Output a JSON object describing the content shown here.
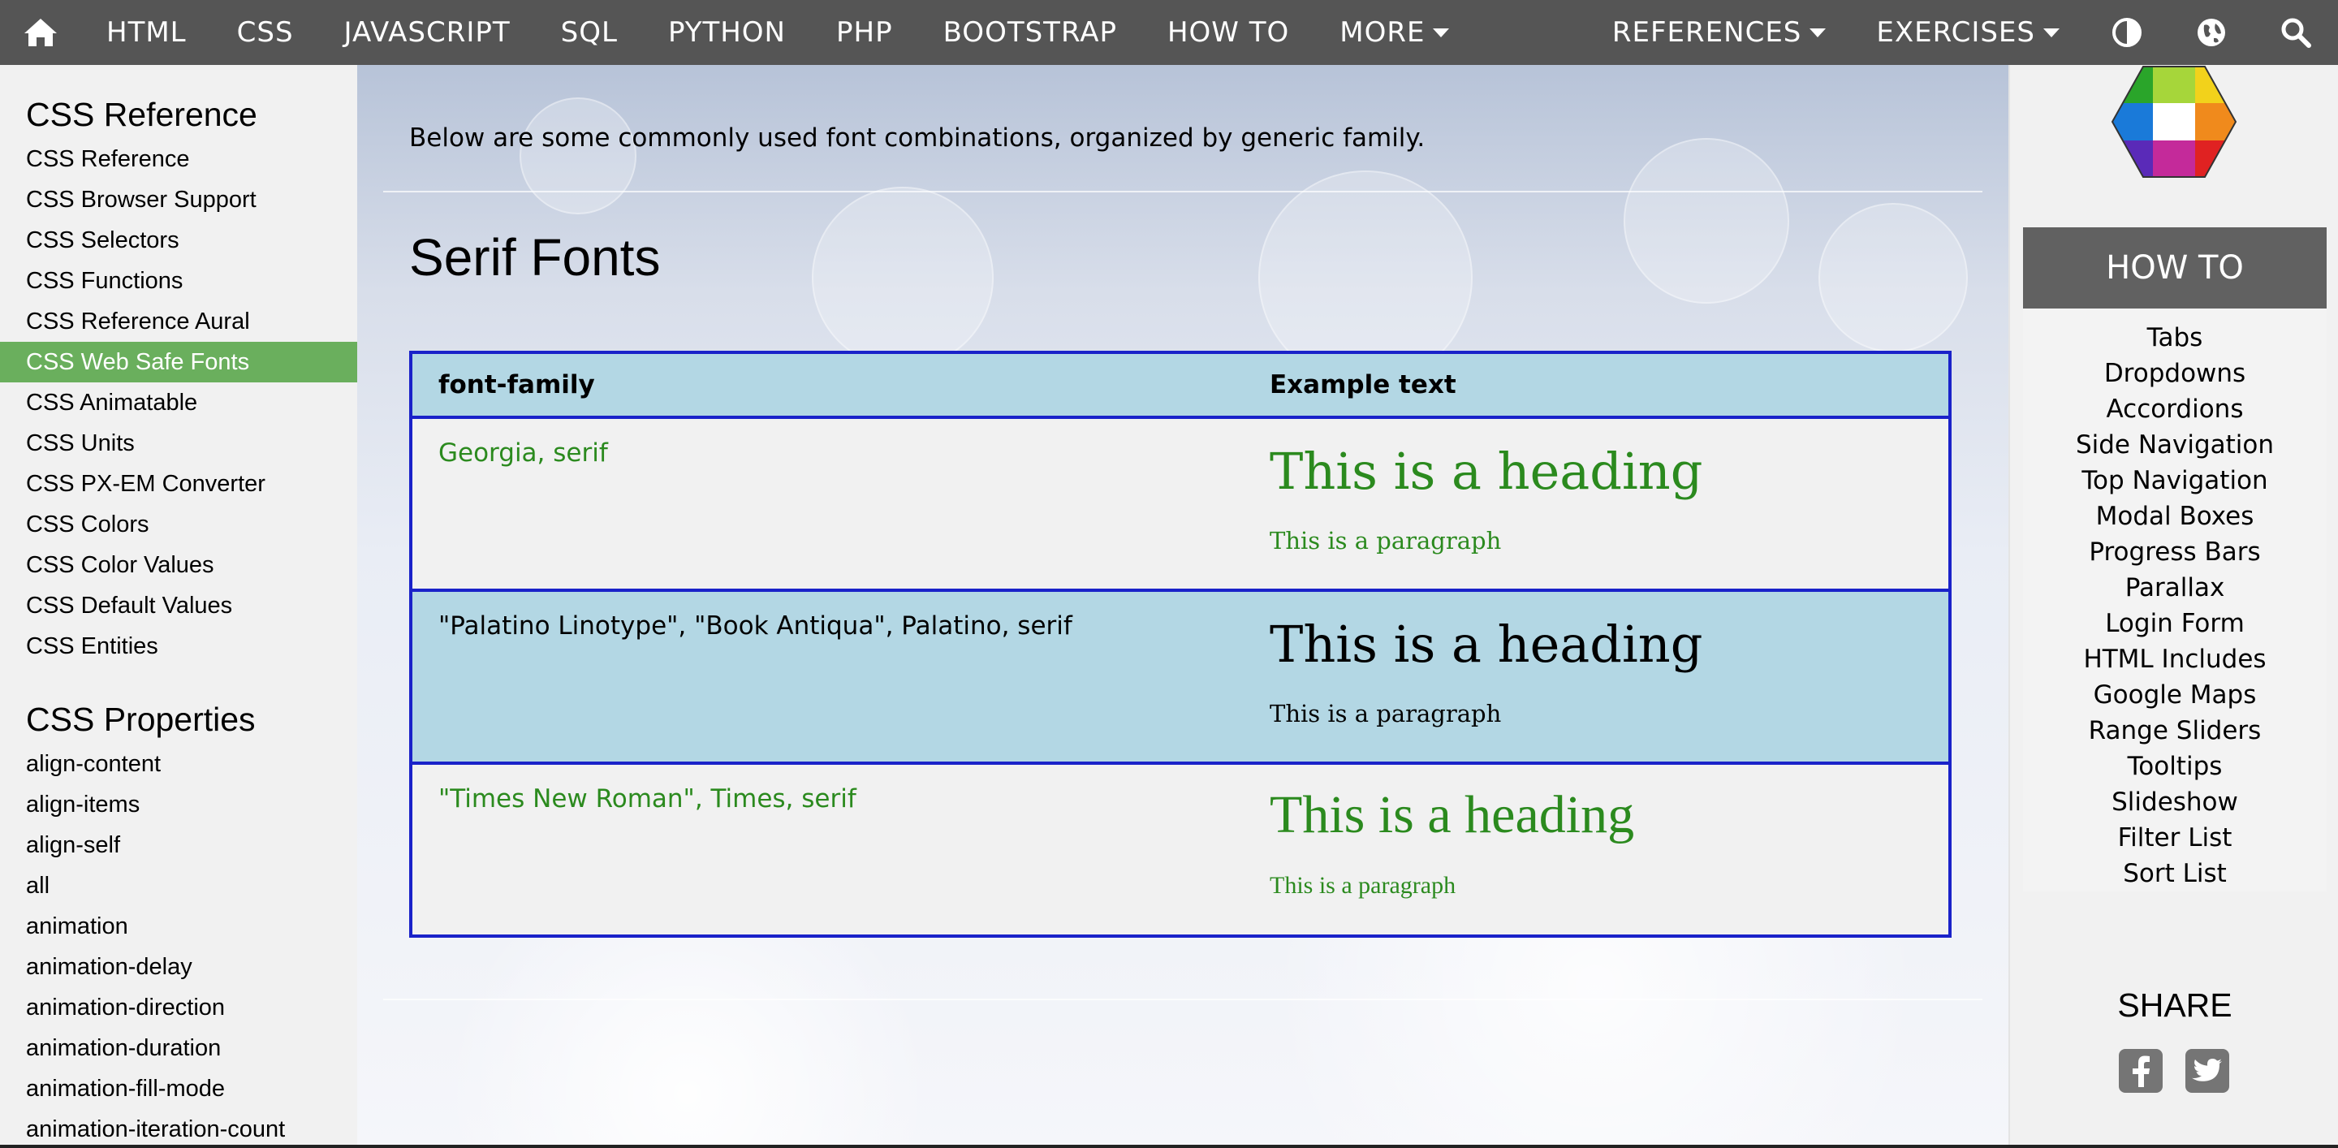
{
  "nav": {
    "items": [
      "HTML",
      "CSS",
      "JAVASCRIPT",
      "SQL",
      "PYTHON",
      "PHP",
      "BOOTSTRAP",
      "HOW TO"
    ],
    "more_label": "MORE",
    "references_label": "REFERENCES",
    "exercises_label": "EXERCISES",
    "icons": [
      "home-icon",
      "contrast-icon",
      "globe-icon",
      "search-icon"
    ],
    "bar_color": "#555555"
  },
  "sidebar": {
    "reference_heading": "CSS Reference",
    "reference_links": [
      "CSS Reference",
      "CSS Browser Support",
      "CSS Selectors",
      "CSS Functions",
      "CSS Reference Aural",
      "CSS Web Safe Fonts",
      "CSS Animatable",
      "CSS Units",
      "CSS PX-EM Converter",
      "CSS Colors",
      "CSS Color Values",
      "CSS Default Values",
      "CSS Entities"
    ],
    "active_link": "CSS Web Safe Fonts",
    "active_color": "#6aaf5d",
    "properties_heading": "CSS Properties",
    "property_links": [
      "align-content",
      "align-items",
      "align-self",
      "all",
      "animation",
      "animation-delay",
      "animation-direction",
      "animation-duration",
      "animation-fill-mode",
      "animation-iteration-count"
    ]
  },
  "main": {
    "intro": "Below are some commonly used font combinations, organized by generic family.",
    "section_title": "Serif Fonts",
    "table": {
      "headers": [
        "font-family",
        "Example text"
      ],
      "rows": [
        {
          "family": "Georgia, serif",
          "heading": "This is a heading",
          "paragraph": "This is a paragraph",
          "color": "#2b8a1e"
        },
        {
          "family": "\"Palatino Linotype\", \"Book Antiqua\", Palatino, serif",
          "heading": "This is a heading",
          "paragraph": "This is a paragraph",
          "color": "#000000"
        },
        {
          "family": "\"Times New Roman\", Times, serif",
          "heading": "This is a heading",
          "paragraph": "This is a paragraph",
          "color": "#2b8a1e"
        }
      ],
      "border_color": "#1a22c9",
      "highlight_color": "#b3d7e4"
    }
  },
  "rightcol": {
    "howto_title": "HOW TO",
    "howto_links": [
      "Tabs",
      "Dropdowns",
      "Accordions",
      "Side Navigation",
      "Top Navigation",
      "Modal Boxes",
      "Progress Bars",
      "Parallax",
      "Login Form",
      "HTML Includes",
      "Google Maps",
      "Range Sliders",
      "Tooltips",
      "Slideshow",
      "Filter List",
      "Sort List"
    ],
    "share_title": "SHARE",
    "share_icons": [
      "facebook-icon",
      "twitter-icon"
    ]
  }
}
